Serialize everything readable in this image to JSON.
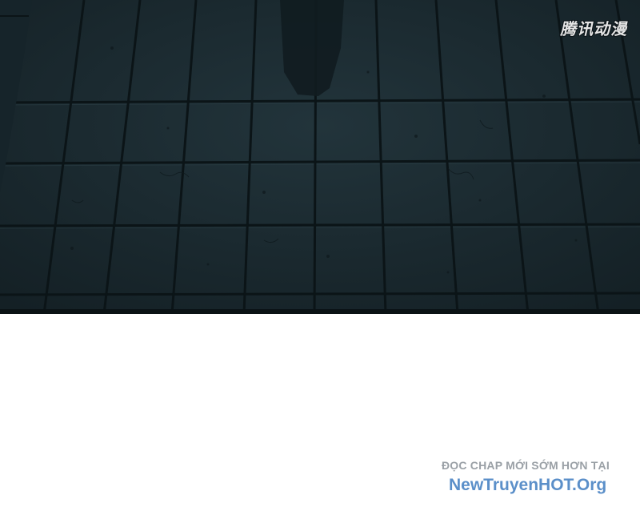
{
  "panel": {
    "description_icon": "tiled-floor-artwork",
    "colors": {
      "floor": "#1b2a30",
      "grout": "#0c1518",
      "shadow": "#111c20"
    }
  },
  "watermark": {
    "text": "腾讯动漫"
  },
  "promo": {
    "line1": "ĐỌC CHAP MỚI SỚM HƠN TẠI",
    "line2": "NewTruyenHOT.Org",
    "colors": {
      "line1": "#9aa0a6",
      "line2": "#5b8fc9"
    }
  }
}
